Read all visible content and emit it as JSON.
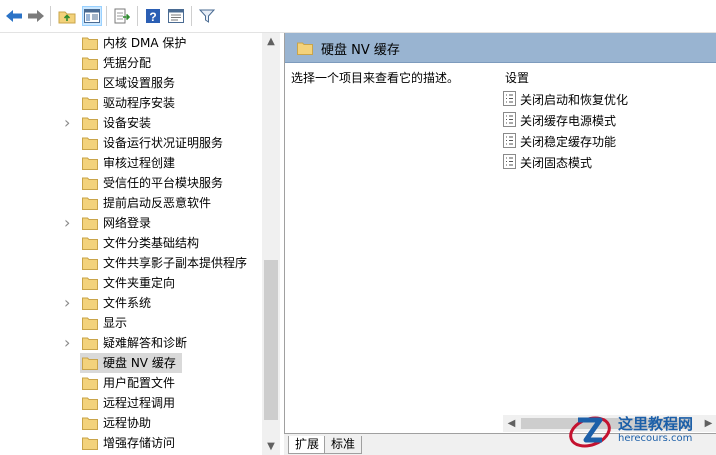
{
  "toolbar": {
    "buttons": [
      "back-arrow-icon",
      "forward-arrow-icon",
      "up-folder-icon",
      "show-hide-tree-icon",
      "export-list-icon",
      "help-icon",
      "properties-icon",
      "filter-icon"
    ]
  },
  "tree": {
    "items": [
      {
        "label": "内核 DMA 保护",
        "expandable": false
      },
      {
        "label": "凭据分配",
        "expandable": false
      },
      {
        "label": "区域设置服务",
        "expandable": false
      },
      {
        "label": "驱动程序安装",
        "expandable": false
      },
      {
        "label": "设备安装",
        "expandable": true
      },
      {
        "label": "设备运行状况证明服务",
        "expandable": false
      },
      {
        "label": "审核过程创建",
        "expandable": false
      },
      {
        "label": "受信任的平台模块服务",
        "expandable": false
      },
      {
        "label": "提前启动反恶意软件",
        "expandable": false
      },
      {
        "label": "网络登录",
        "expandable": true
      },
      {
        "label": "文件分类基础结构",
        "expandable": false
      },
      {
        "label": "文件共享影子副本提供程序",
        "expandable": false
      },
      {
        "label": "文件夹重定向",
        "expandable": false
      },
      {
        "label": "文件系统",
        "expandable": true
      },
      {
        "label": "显示",
        "expandable": false
      },
      {
        "label": "疑难解答和诊断",
        "expandable": true
      },
      {
        "label": "硬盘 NV 缓存",
        "expandable": false,
        "selected": true
      },
      {
        "label": "用户配置文件",
        "expandable": false
      },
      {
        "label": "远程过程调用",
        "expandable": false
      },
      {
        "label": "远程协助",
        "expandable": false
      },
      {
        "label": "增强存储访问",
        "expandable": false
      }
    ]
  },
  "right": {
    "header_title": "硬盘 NV 缓存",
    "description": "选择一个项目来查看它的描述。",
    "settings_header": "设置",
    "settings": [
      "关闭启动和恢复优化",
      "关闭缓存电源模式",
      "关闭稳定缓存功能",
      "关闭固态模式"
    ]
  },
  "tabs": [
    "扩展",
    "标准"
  ],
  "watermark": {
    "name": "这里教程网",
    "url": "herecours.com"
  },
  "colors": {
    "header_bg": "#99b4d1",
    "folder": "#f3d27b",
    "accent": "#1c5fa8"
  }
}
